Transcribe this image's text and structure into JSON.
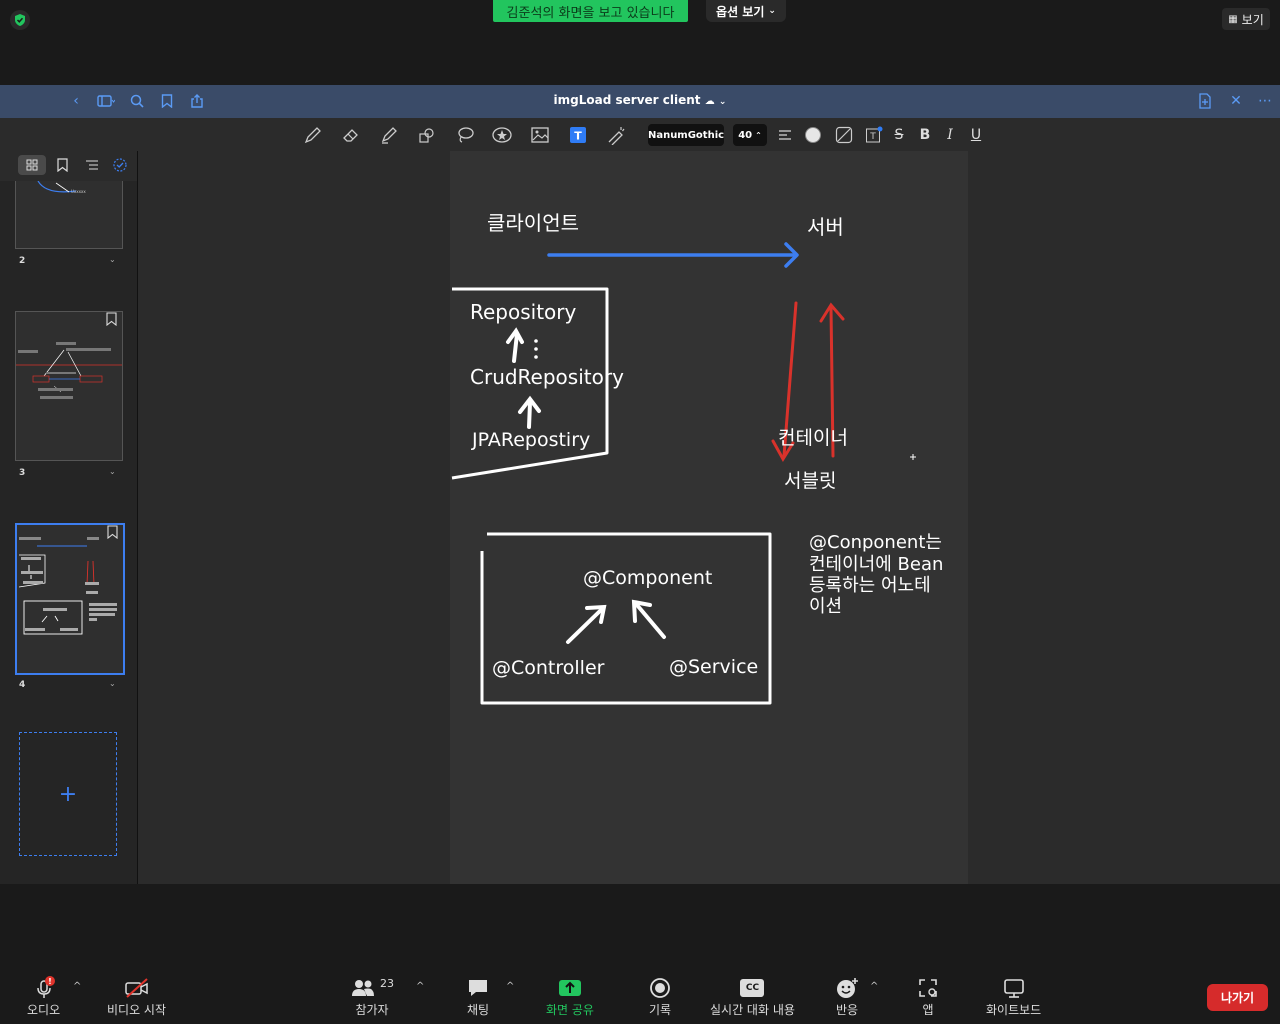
{
  "zoom": {
    "share_banner": "김준석의 화면을 보고 있습니다",
    "options_label": "옵션 보기",
    "view_label": "보기"
  },
  "app": {
    "doc_title": "imgLoad server client",
    "font_name": "NanumGothic",
    "font_size": "40"
  },
  "sidebar": {
    "pages": [
      {
        "number": "2"
      },
      {
        "number": "3"
      },
      {
        "number": "4"
      }
    ],
    "add_symbol": "+"
  },
  "note": {
    "client": "클라이언트",
    "server": "서버",
    "repository": "Repository",
    "crud_repository": "CrudRepository",
    "jpa_repository": "JPARepostiry",
    "container": "컨테이너",
    "servlet": "서블릿",
    "component": "@Component",
    "controller": "@Controller",
    "service": "@Service",
    "component_note_1": "@Conponent는",
    "component_note_2": "컨테이너에 Bean",
    "component_note_3": "등록하는 어노테",
    "component_note_4": "이션"
  },
  "controls": {
    "audio": "오디오",
    "video": "비디오 시작",
    "participants": "참가자",
    "participants_count": "23",
    "chat": "채팅",
    "share": "화면 공유",
    "record": "기록",
    "captions": "실시간 대화 내용",
    "reactions": "반응",
    "apps": "앱",
    "whiteboard": "화이트보드",
    "leave": "나가기",
    "cc_badge": "CC"
  },
  "colors": {
    "share_green": "#22c55e",
    "titlebar_blue": "#3a4b68",
    "accent_blue": "#3d7ef0",
    "pen_red": "#d9322b",
    "leave_red": "#d62b2b"
  }
}
